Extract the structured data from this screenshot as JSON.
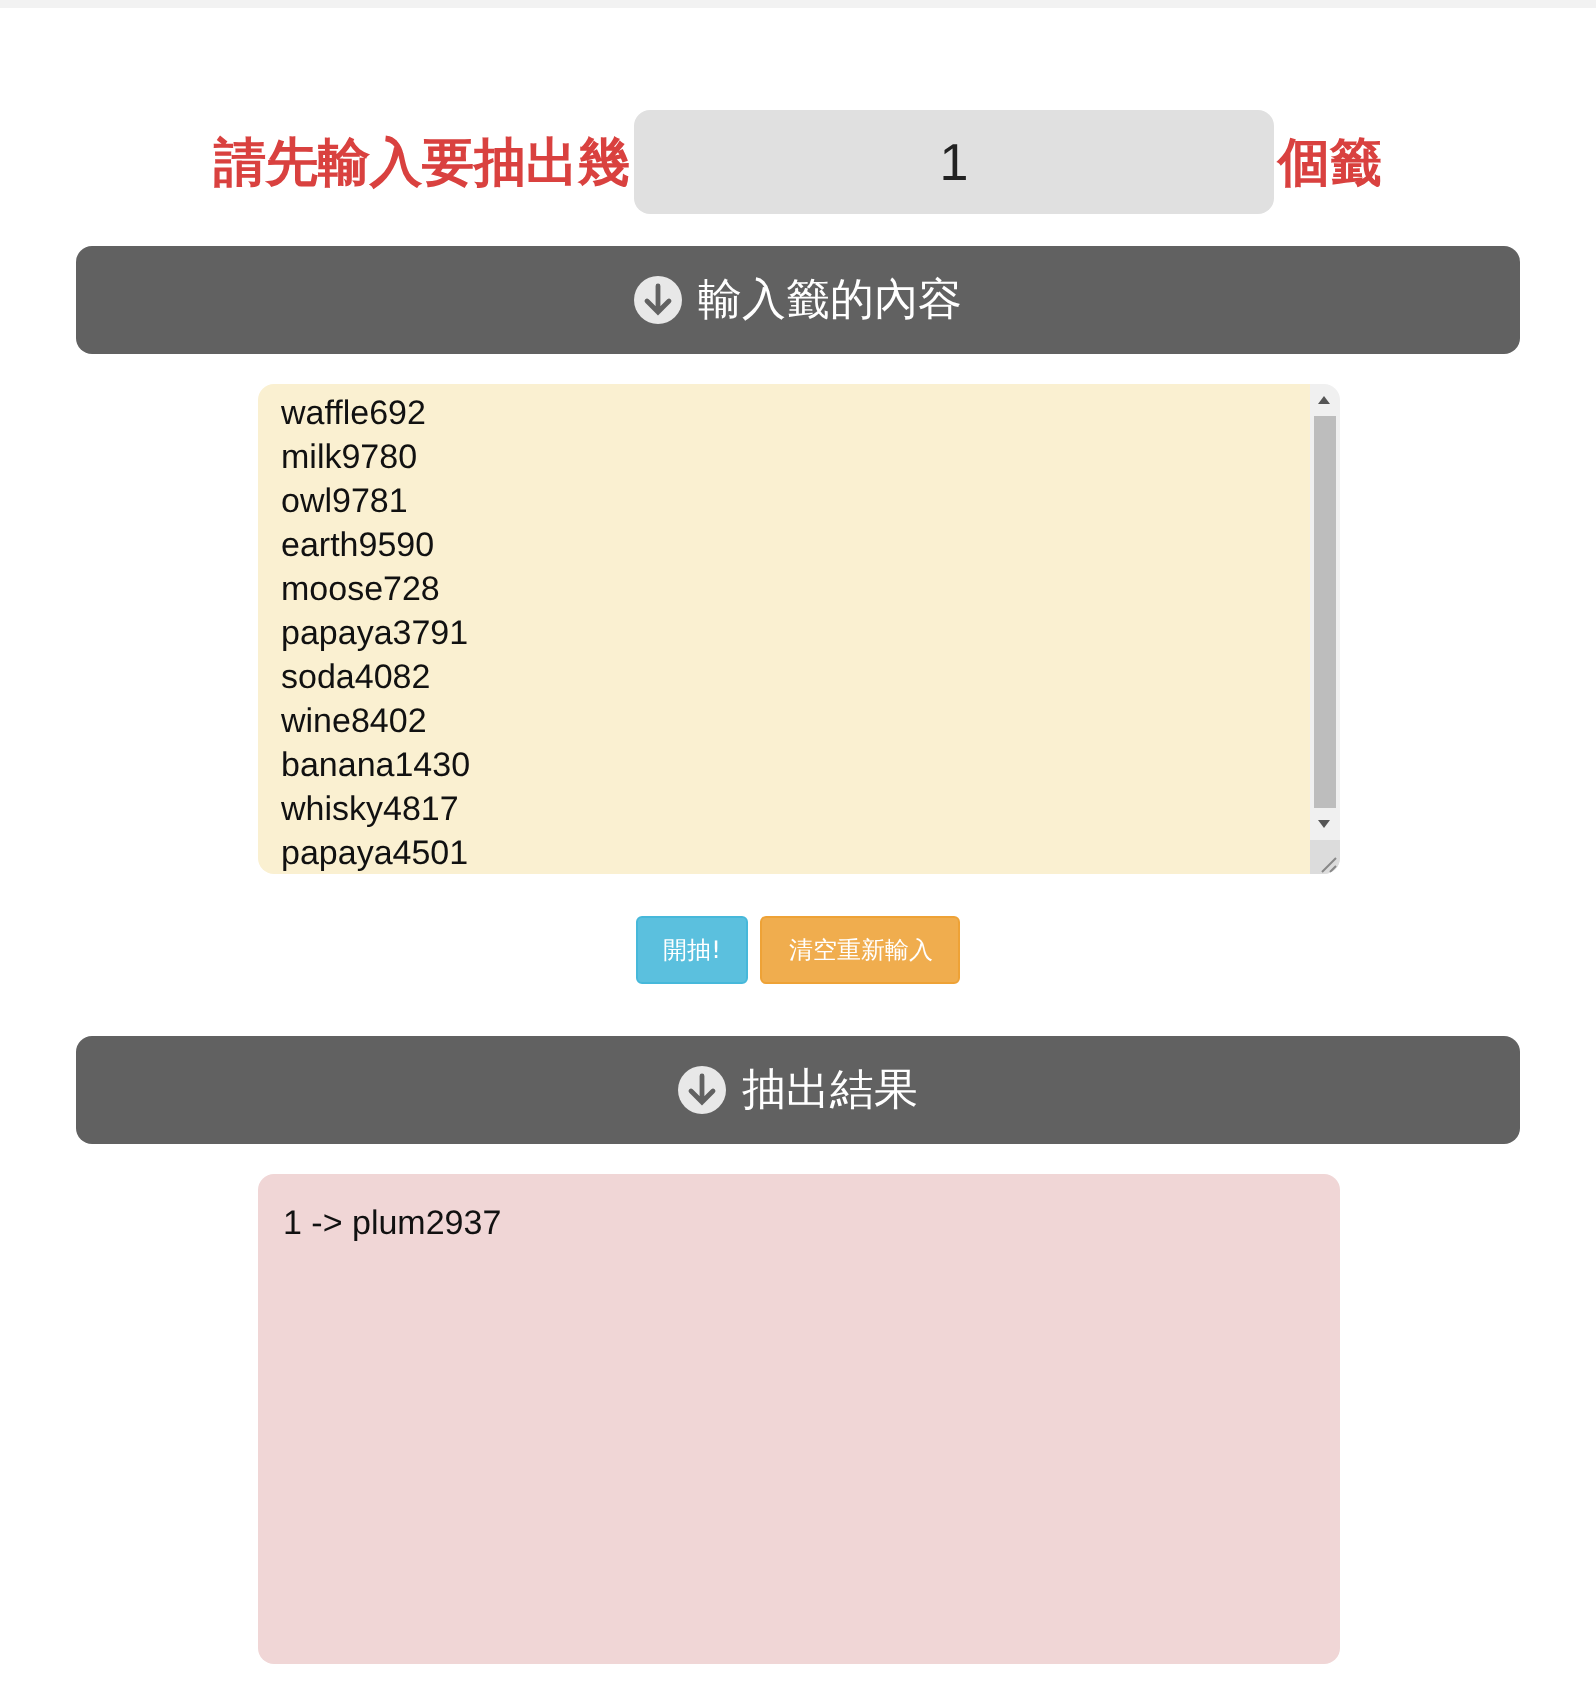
{
  "count_prompt": {
    "label": "請先輸入要抽出幾",
    "value": "1",
    "suffix": "個籤"
  },
  "input_section": {
    "title": "輸入籤的內容"
  },
  "entries": {
    "lines": [
      "waffle692",
      "milk9780",
      "owl9781",
      "earth9590",
      "moose728",
      "papaya3791",
      "soda4082",
      "wine8402",
      "banana1430",
      "whisky4817",
      "papaya4501"
    ]
  },
  "buttons": [
    {
      "label": "開抽!",
      "kind": "primary"
    },
    {
      "label": "清空重新輸入",
      "kind": "warning"
    }
  ],
  "result_section": {
    "title": "抽出結果"
  },
  "result": {
    "lines": [
      "1 -> plum2937"
    ]
  }
}
